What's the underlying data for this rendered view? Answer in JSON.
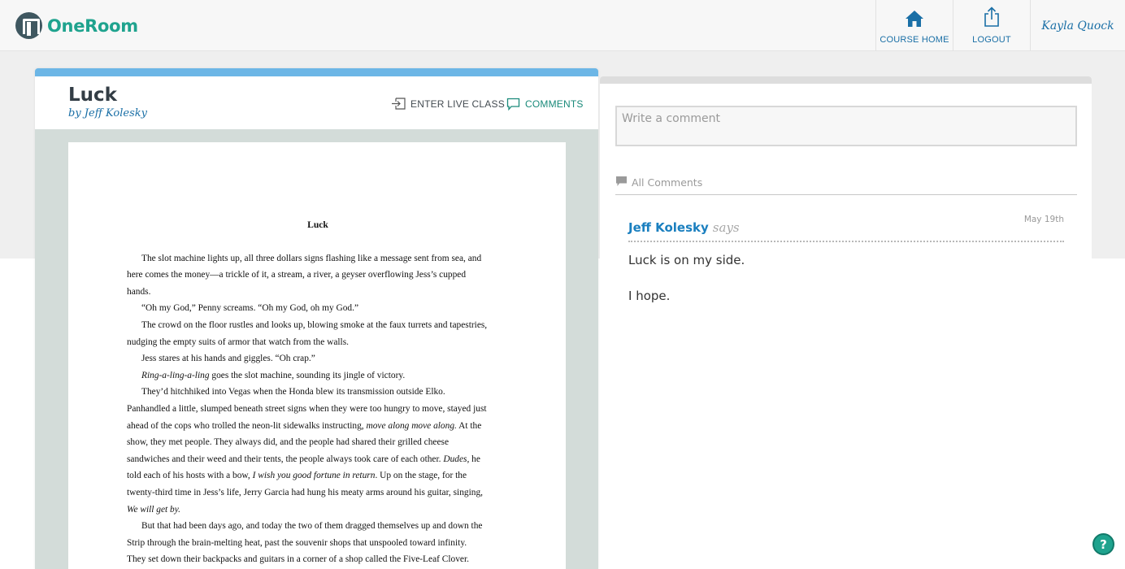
{
  "app": {
    "name": "OneRoom"
  },
  "nav": {
    "course_home": "COURSE HOME",
    "logout": "LOGOUT",
    "user": "Kayla Quock"
  },
  "document": {
    "title": "Luck",
    "author": "by Jeff Kolesky",
    "actions": {
      "live_class": "ENTER LIVE CLASS",
      "comments": "COMMENTS"
    },
    "page": {
      "title": "Luck",
      "lines": [
        {
          "text": "The slot machine lights up, all three dollars signs flashing like a message sent from sea, and",
          "indent": true
        },
        {
          "text": "here comes the money—a trickle of it, a stream, a river, a geyser overflowing Jess’s cupped",
          "indent": false
        },
        {
          "text": "hands.",
          "indent": false
        },
        {
          "text": "“Oh my God,” Penny screams. “Oh my God, oh my God.”",
          "indent": true
        },
        {
          "text": "The crowd on the floor rustles and looks up, blowing smoke at the faux turrets and tapestries,",
          "indent": true
        },
        {
          "text": "nudging the empty suits of armor that watch from the walls.",
          "indent": false
        },
        {
          "text": "Jess stares at his hands and giggles. “Oh crap.”",
          "indent": true
        },
        {
          "italic": "Ring-a-ling-a-ling",
          "text": " goes the slot machine, sounding its jingle of victory.",
          "indent": true
        },
        {
          "text": "They’d hitchhiked into Vegas when the Honda blew its transmission outside Elko.",
          "indent": true
        },
        {
          "text": "Panhandled a little, slumped beneath street signs when they were too hungry to move, stayed just",
          "indent": false
        },
        {
          "text": "ahead of the cops who trolled the neon-lit sidewalks instructing, ",
          "italic_after": "move along move along.",
          "text_after": " At the",
          "indent": false
        },
        {
          "text": "show, they met people. They always did, and the people had shared their grilled cheese",
          "indent": false
        },
        {
          "text": "sandwiches and their weed and their tents, the people always took care of each other. ",
          "italic_after": "Dudes,",
          "text_after": " he",
          "indent": false
        },
        {
          "text": "told each of his hosts with a bow, ",
          "italic_after": "I wish you good fortune in return",
          "text_after": ". Up on the stage, for the",
          "indent": false
        },
        {
          "text": "twenty-third time in Jess’s life, Jerry Garcia had hung his meaty arms around his guitar, singing,",
          "indent": false
        },
        {
          "italic": "We will get by.",
          "text": "",
          "indent": false
        },
        {
          "text": "But that had been days ago, and today the two of them dragged themselves up and down the",
          "indent": true
        },
        {
          "text": "Strip through the brain-melting heat, past the souvenir shops that unspooled toward infinity.",
          "indent": false
        },
        {
          "text": "They set down their backpacks and guitars in a corner of a shop called the Five-Leaf Clover.",
          "indent": false
        }
      ]
    }
  },
  "comments_panel": {
    "placeholder": "Write a comment",
    "all_label": "All Comments",
    "items": [
      {
        "author": "Jeff Kolesky",
        "says": "says",
        "date": "May 19th",
        "body": [
          "Luck is on my side.",
          "I hope."
        ]
      }
    ]
  },
  "help": {
    "label": "?"
  },
  "colors": {
    "brand": "#1fa38e",
    "link": "#1a6fa6",
    "accent_strip": "#6cb6e6"
  },
  "icons": [
    "logo-icon",
    "home-icon",
    "logout-icon",
    "enter-class-icon",
    "comment-icon",
    "comments-list-icon",
    "help-icon"
  ]
}
